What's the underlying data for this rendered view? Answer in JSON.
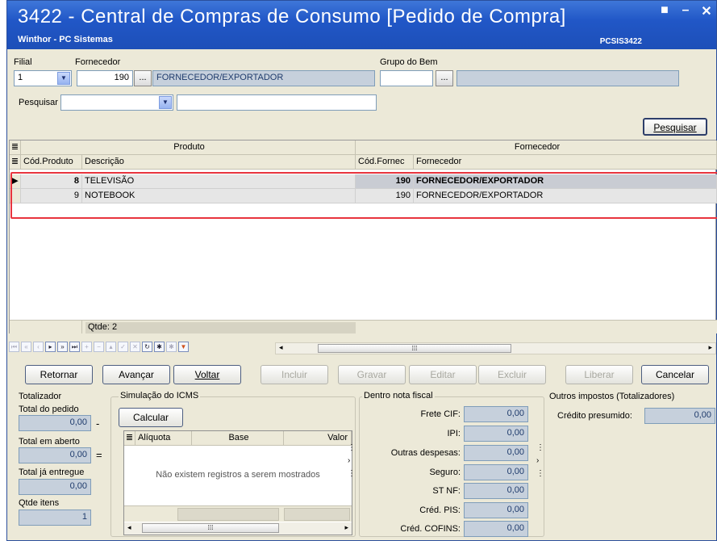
{
  "window": {
    "title": "3422 - Central de Compras de Consumo [Pedido de Compra]",
    "subtitle": "Winthor - PC Sistemas",
    "code": "PCSIS3422",
    "minimize_glyph": "–",
    "restore_glyph": "■",
    "close_glyph": "✕"
  },
  "filters": {
    "filial_label": "Filial",
    "filial_value": "1",
    "fornecedor_label": "Fornecedor",
    "fornecedor_code": "190",
    "fornecedor_name": "FORNECEDOR/EXPORTADOR",
    "grupo_label": "Grupo do Bem",
    "grupo_code": "",
    "grupo_name": "",
    "pesquisar_por_label": "Pesquisar por",
    "pesquisar_por_value": "",
    "search_text": "",
    "lookup_label": "...",
    "pesquisar_button": "Pesquisar"
  },
  "grid": {
    "group_headers": [
      "Produto",
      "Fornecedor"
    ],
    "columns": [
      "Cód.Produto",
      "Descrição",
      "Cód.Fornec",
      "Fornecedor"
    ],
    "rows": [
      {
        "cod_produto": "8",
        "descricao": "TELEVISÃO",
        "cod_fornec": "190",
        "fornecedor": "FORNECEDOR/EXPORTADOR",
        "selected": true
      },
      {
        "cod_produto": "9",
        "descricao": "NOTEBOOK",
        "cod_fornec": "190",
        "fornecedor": "FORNECEDOR/EXPORTADOR",
        "selected": false
      }
    ],
    "footer_qtde": "Qtde: 2"
  },
  "actions": {
    "retornar": "Retornar",
    "avancar": "Avançar",
    "voltar": "Voltar",
    "incluir": "Incluir",
    "gravar": "Gravar",
    "editar": "Editar",
    "excluir": "Excluir",
    "liberar": "Liberar",
    "cancelar": "Cancelar"
  },
  "totalizador": {
    "legend": "Totalizador",
    "total_pedido_label": "Total do pedido",
    "total_pedido_value": "0,00",
    "total_pedido_op": "-",
    "total_aberto_label": "Total em aberto",
    "total_aberto_value": "0,00",
    "total_aberto_op": "=",
    "total_entregue_label": "Total já entregue",
    "total_entregue_value": "0,00",
    "qtde_itens_label": "Qtde itens",
    "qtde_itens_value": "1"
  },
  "icms": {
    "legend": "Simulação do ICMS",
    "calcular_button": "Calcular",
    "columns": [
      "Alíquota",
      "Base",
      "Valor"
    ],
    "empty_message": "Não existem registros a serem mostrados"
  },
  "nota_fiscal": {
    "legend": "Dentro nota fiscal",
    "items": [
      {
        "label": "Frete CIF:",
        "value": "0,00"
      },
      {
        "label": "IPI:",
        "value": "0,00"
      },
      {
        "label": "Outras despesas:",
        "value": "0,00"
      },
      {
        "label": "Seguro:",
        "value": "0,00"
      },
      {
        "label": "ST NF:",
        "value": "0,00"
      },
      {
        "label": "Créd. PIS:",
        "value": "0,00"
      },
      {
        "label": "Créd. COFINS:",
        "value": "0,00"
      }
    ]
  },
  "outros": {
    "legend": "Outros impostos (Totalizadores)",
    "credito_label": "Crédito presumido:",
    "credito_value": "0,00"
  }
}
